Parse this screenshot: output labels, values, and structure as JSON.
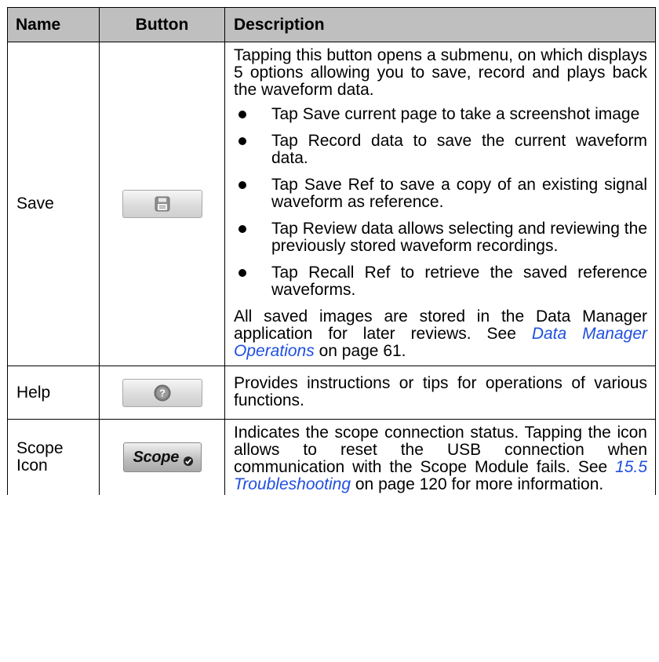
{
  "table": {
    "headers": [
      "Name",
      "Button",
      "Description"
    ],
    "rows": [
      {
        "name": "Save",
        "button_icon": "save-icon",
        "intro": "Tapping this button opens a submenu, on which displays 5 options allowing you to save, record and plays back the waveform data.",
        "bullets": [
          "Tap Save current page to take a screenshot image",
          "Tap Record data to save the current waveform data.",
          "Tap Save Ref to save a copy of an existing signal waveform as reference.",
          "Tap Review data allows selecting and reviewing the previously stored waveform recordings.",
          "Tap Recall Ref to retrieve the saved reference waveforms."
        ],
        "outro_before": "All saved images are stored in the Data Manager application for later reviews. See ",
        "outro_link": "Data Manager Operations",
        "outro_after": " on page 61."
      },
      {
        "name": "Help",
        "button_icon": "help-icon",
        "description": "Provides instructions or tips for operations of various functions."
      },
      {
        "name": "Scope Icon",
        "button_label": "Scope",
        "button_icon": "scope-connection-icon",
        "desc_before": "Indicates the scope connection status. Tapping the icon allows to reset the USB connection when communication with the Scope Module fails. See ",
        "desc_link": "15.5 Troubleshooting",
        "desc_after": " on page 120 for more information."
      }
    ]
  },
  "colors": {
    "header_bg": "#bfbfbf",
    "link": "#1f4fe0",
    "border": "#000000"
  }
}
